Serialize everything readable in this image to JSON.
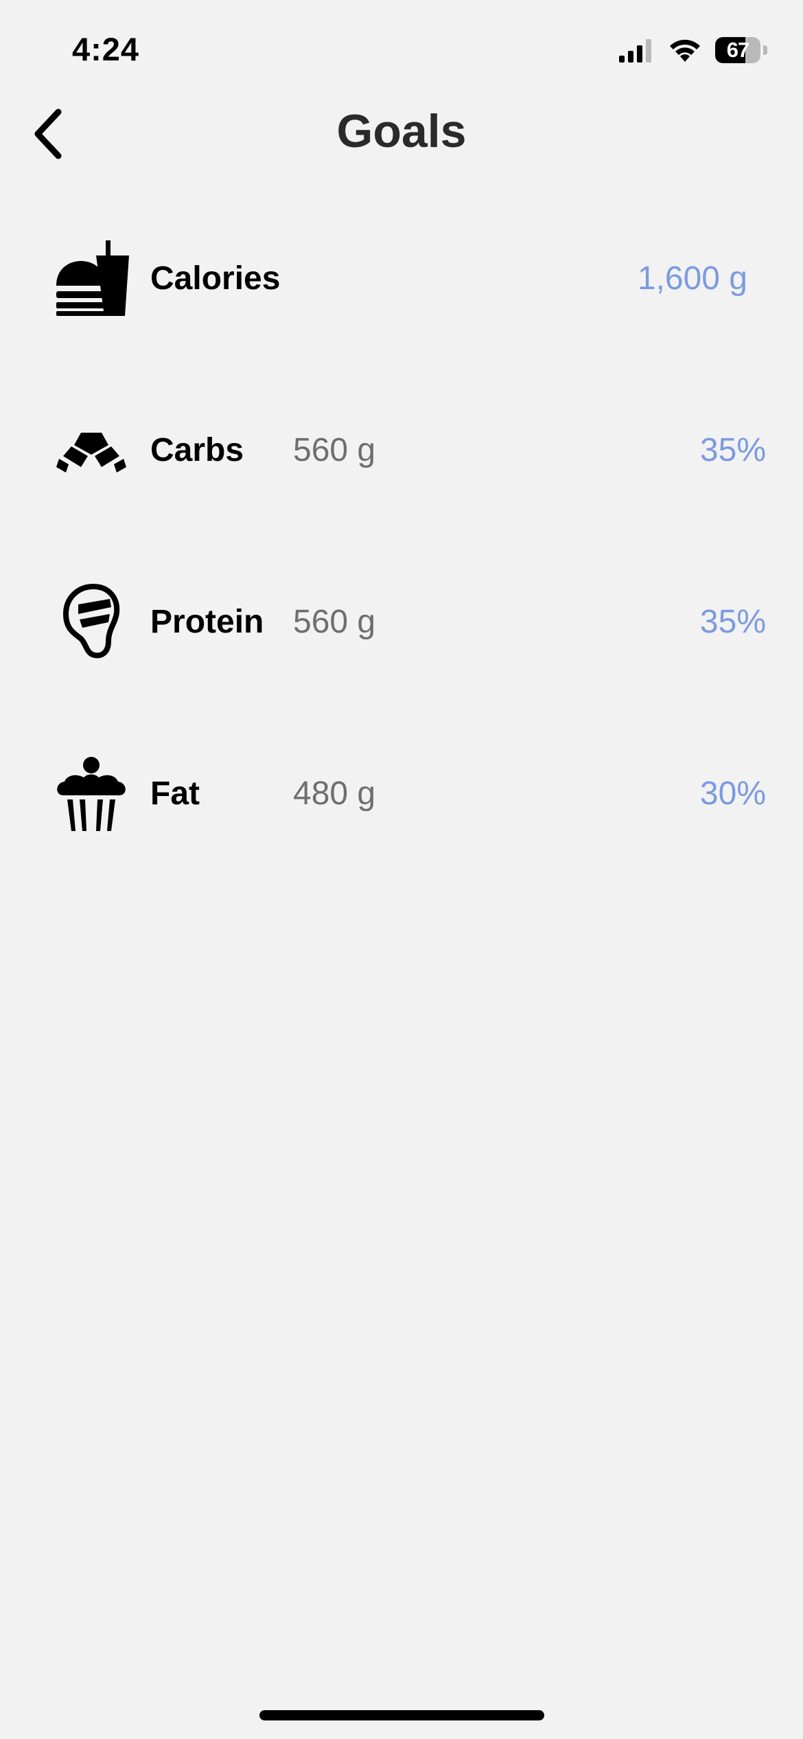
{
  "status_bar": {
    "time": "4:24",
    "battery_percent": "67",
    "battery_level": 0.67
  },
  "nav": {
    "title": "Goals"
  },
  "goals": [
    {
      "label": "Calories",
      "grams": "",
      "value": "1,600 g",
      "icon": "burger-drink-icon"
    },
    {
      "label": "Carbs",
      "grams": "560 g",
      "value": "35%",
      "icon": "croissant-icon"
    },
    {
      "label": "Protein",
      "grams": "560 g",
      "value": "35%",
      "icon": "steak-icon"
    },
    {
      "label": "Fat",
      "grams": "480 g",
      "value": "30%",
      "icon": "cupcake-icon"
    }
  ],
  "colors": {
    "background": "#f2f2f2",
    "accent": "#7b9be0",
    "secondary_text": "#6e6e6e"
  }
}
